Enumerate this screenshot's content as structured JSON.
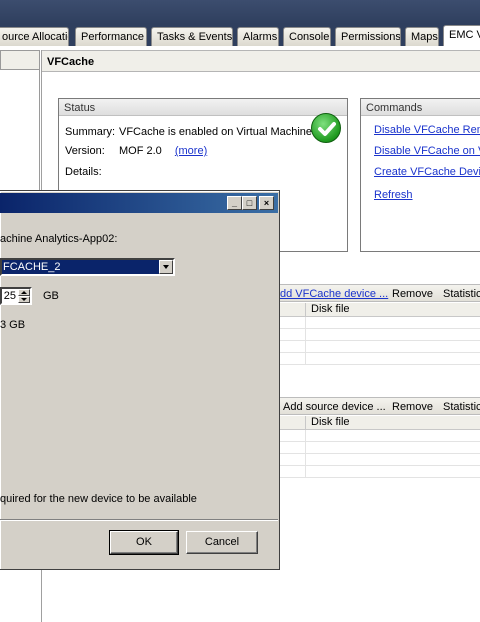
{
  "tabs": [
    {
      "label": "ource Allocation",
      "active": false
    },
    {
      "label": "Performance",
      "active": false
    },
    {
      "label": "Tasks & Events",
      "active": false
    },
    {
      "label": "Alarms",
      "active": false
    },
    {
      "label": "Console",
      "active": false
    },
    {
      "label": "Permissions",
      "active": false
    },
    {
      "label": "Maps",
      "active": false
    },
    {
      "label": "EMC V",
      "active": true
    }
  ],
  "vfcache": {
    "title": "VFCache",
    "status": {
      "title": "Status",
      "summary_label": "Summary:",
      "summary_value": "VFCache is enabled on Virtual Machine",
      "version_label": "Version:",
      "version_value": "MOF 2.0",
      "more_link": "(more)",
      "details_label": "Details:",
      "icon": "check-ok-icon"
    },
    "commands": {
      "title": "Commands",
      "items": [
        "Disable VFCache Remot",
        "Disable VFCache on Vir",
        "Create VFCache Device",
        "Refresh"
      ]
    },
    "cache_devices": {
      "add_label": "dd VFCache device ...",
      "remove_label": "Remove",
      "statistics_label": "Statistic",
      "column_disk_file": "Disk file"
    },
    "source_devices": {
      "add_label": "Add source device ...",
      "remove_label": "Remove",
      "statistics_label": "Statistic",
      "column_disk_file": "Disk file"
    }
  },
  "dialog": {
    "prompt": "achine Analytics-App02:",
    "selected_device": "FCACHE_2",
    "size_value": "25",
    "size_unit": "GB",
    "available_text": "3 GB",
    "note": "quired for the new device to be available",
    "ok_label": "OK",
    "cancel_label": "Cancel",
    "colors": {
      "titlebar": "#0a246a",
      "face": "#d4d0c8"
    }
  }
}
